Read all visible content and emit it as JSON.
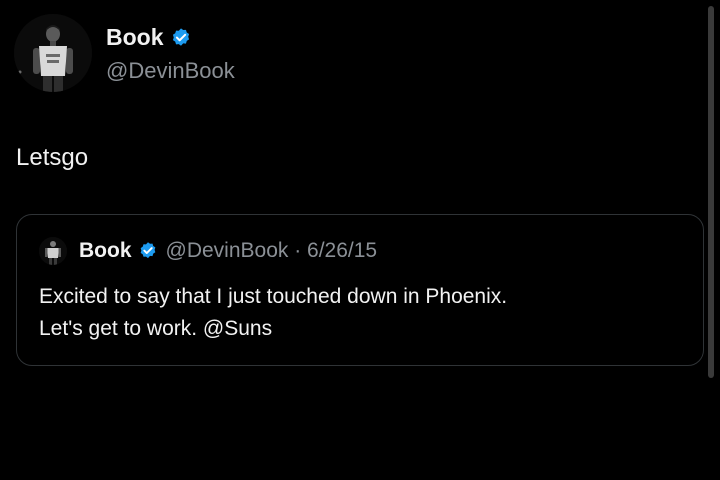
{
  "post": {
    "author_name": "Book",
    "author_handle": "@DevinBook",
    "verified": true,
    "text": "Letsgo"
  },
  "quoted_post": {
    "author_name": "Book",
    "meta": "@DevinBook · 6/26/15",
    "text_line_1": "Excited to say that I just touched down in Phoenix.",
    "text_line_2": "Let's get to work. @Suns"
  },
  "colors": {
    "background": "#000000",
    "primary_text": "#f2f2f2",
    "secondary_text": "#8b9096",
    "verified_blue": "#1d9bf0",
    "card_border": "#2f3336"
  },
  "icons": {
    "verified": "verified-badge-icon",
    "avatar": "profile-photo"
  }
}
